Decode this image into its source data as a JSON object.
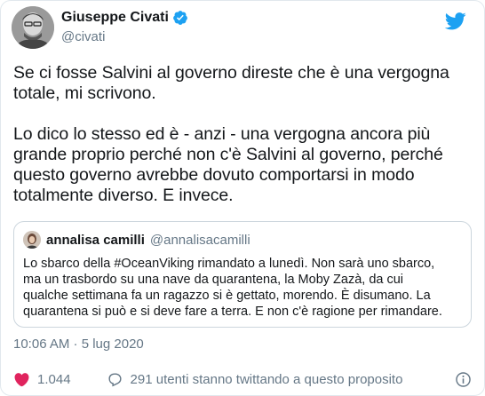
{
  "author": {
    "display_name": "Giuseppe Civati",
    "handle": "@civati",
    "verified": true,
    "avatar_icon": "user-avatar-icon"
  },
  "brand": {
    "logo_icon": "twitter-bird-icon",
    "color": "#1da1f2"
  },
  "tweet": {
    "text": "Se ci fosse Salvini al governo direste che è una vergogna\ntotale, mi scrivono.\n\nLo dico lo stesso ed è - anzi - una vergogna ancora più\ngrande proprio perché non c'è Salvini al governo, perché\nquesto governo avrebbe dovuto comportarsi in modo\ntotalmente diverso. E invece."
  },
  "quoted": {
    "display_name": "annalisa camilli",
    "handle": "@annalisacamilli",
    "text": "Lo sbarco della #OceanViking rimandato a lunedì. Non sarà uno sbarco,\nma un trasbordo su una nave da quarantena, la Moby Zazà, da cui\nqualche settimana fa un ragazzo si è gettato, morendo. È disumano. La\nquarantena si può e si deve fare a terra. E non c'è ragione per rimandare."
  },
  "meta": {
    "timestamp": "10:06 AM · 5 lug 2020"
  },
  "actions": {
    "likes": "1.044",
    "conversation": "291 utenti stanno twittando a questo proposito"
  },
  "colors": {
    "like": "#e0245e",
    "secondary": "#657786",
    "border": "#ccd6dd"
  }
}
